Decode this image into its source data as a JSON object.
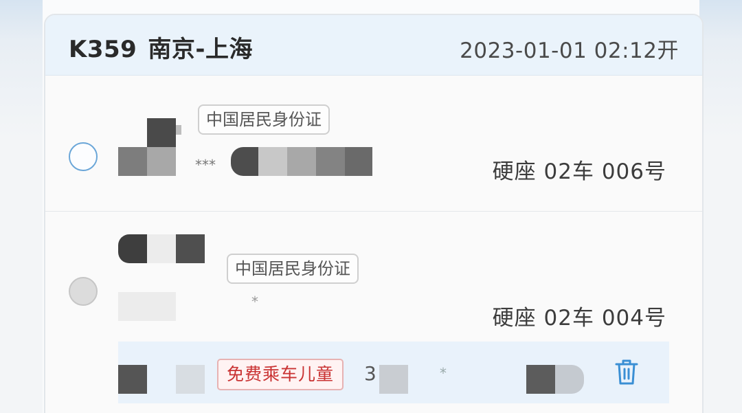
{
  "header": {
    "train_number": "K359",
    "route": "南京-上海",
    "departure": "2023-01-01 02:12开"
  },
  "passengers": [
    {
      "selected": true,
      "id_type": "中国居民身份证",
      "id_masked": "***",
      "seat": "硬座 02车 006号"
    },
    {
      "selected": false,
      "id_type": "中国居民身份证",
      "id_masked": "*",
      "seat": "硬座 02车 004号",
      "child": {
        "badge": "免费乘车儿童",
        "id_fragment": "3",
        "id_masked": "*"
      }
    }
  ],
  "colors": {
    "header_bg": "#eaf3fb",
    "radio_active": "#6aa6d8",
    "child_badge": "#c93232",
    "trash_icon": "#3a8fd4"
  },
  "icons": {
    "delete": "trash-icon"
  }
}
